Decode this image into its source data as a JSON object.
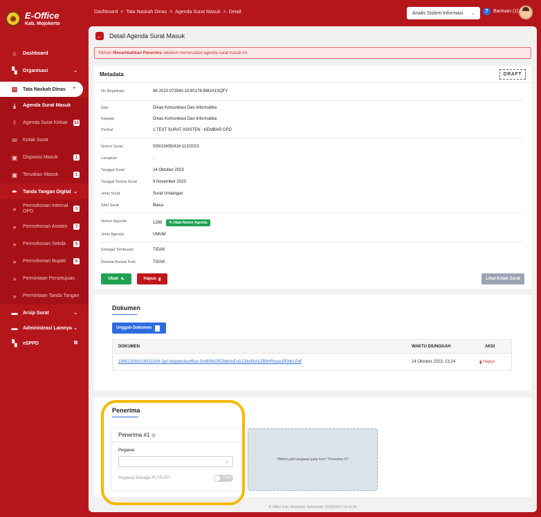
{
  "brand": {
    "title": "E-Office",
    "subtitle": "Kab. Mojokerto"
  },
  "sidebar": {
    "items": [
      {
        "label": "Dashboard",
        "icon": "home-icon"
      },
      {
        "label": "Organisasi",
        "icon": "organization-icon"
      },
      {
        "label": "Tata Naskah Dinas",
        "icon": "document-icon"
      },
      {
        "label": "Agenda Surat Masuk",
        "icon": "inbox-download-icon"
      },
      {
        "label": "Agenda Surat Keluar",
        "icon": "outbox-upload-icon",
        "badge": "52"
      },
      {
        "label": "Kotak Surat",
        "icon": "mail-icon"
      },
      {
        "label": "Disposisi Masuk",
        "icon": "disposition-icon",
        "badge": "1"
      },
      {
        "label": "Teruskan Masuk",
        "icon": "forward-icon",
        "badge": "1"
      },
      {
        "label": "Tanda Tangan Digital",
        "icon": "pen-nib-icon"
      },
      {
        "label": "Permohonan Internal OPD",
        "icon": "arrow-icon",
        "badge": "3"
      },
      {
        "label": "Permohonan Asisten",
        "icon": "arrow-icon",
        "badge": "7"
      },
      {
        "label": "Permohonan Sekda",
        "icon": "arrow-icon",
        "badge": "5"
      },
      {
        "label": "Permohonan Bupati",
        "icon": "arrow-icon",
        "badge": "5"
      },
      {
        "label": "Permintaan Persetujuan",
        "icon": "arrow-icon"
      },
      {
        "label": "Permintaan Tanda Tangan",
        "icon": "arrow-icon"
      },
      {
        "label": "Arsip Surat",
        "icon": "archive-icon"
      },
      {
        "label": "Administrasi Lainnya",
        "icon": "admin-icon"
      },
      {
        "label": "eSPPD",
        "icon": "file-icon"
      }
    ]
  },
  "breadcrumb": [
    "Dashboard",
    "Tata Naskah Dinas",
    "Agenda Surat Masuk",
    "Detail"
  ],
  "topbar": {
    "unit": "Analis Sistem Informasi",
    "help_label": "Bantuan (1)"
  },
  "page": {
    "title": "Detail Agenda Surat Masuk",
    "alert_prefix": "Mohon",
    "alert_bold": "Menambahkan Penerima",
    "alert_suffix": "sebelum meneruskan agenda surat masuk ini."
  },
  "metadata": {
    "title": "Metadata",
    "status": "DRAFT",
    "rows": [
      {
        "k": "No Registrasi",
        "v": "IM-2023.073540.10-80178-B8UH1SQFY"
      },
      {
        "k": "Dari",
        "v": "Dinas Komunikasi Dan Informatika"
      },
      {
        "k": "Kepada",
        "v": "Dinas Komunikasi Dan Informatika"
      },
      {
        "k": "Perihal",
        "v": "1 TEST SURAT ASISTEN - KEMBAR OPD"
      },
      {
        "k": "Nomor Surat",
        "v": "000/13405/416-113/2023"
      },
      {
        "k": "Lampiran",
        "v": "-"
      },
      {
        "k": "Tanggal Surat",
        "v": "24 Oktober 2023"
      },
      {
        "k": "Tanggal Terima Surat",
        "v": "9 November 2023"
      },
      {
        "k": "Jenis Surat",
        "v": "Surat Undangan"
      },
      {
        "k": "Sifat Surat",
        "v": "Biasa"
      },
      {
        "k": "Nomor Agenda",
        "v": "1288"
      },
      {
        "k": "Jenis Agenda",
        "v": "UMUM"
      },
      {
        "k": "Sebagai Tembusan",
        "v": "TIDAK"
      },
      {
        "k": "Disertai Berkas Fisik",
        "v": "TIDAK"
      }
    ],
    "ubah_nomor_label": "Ubah Nomor Agenda",
    "ubah_label": "Ubah",
    "hapus_label": "Hapus",
    "lihat_label": "Lihat Kotak Surat"
  },
  "dokumen": {
    "title": "Dokumen",
    "upload_label": "Unggah Dokumen",
    "columns": [
      "DOKUMEN",
      "WAKTU DIUNGGAH",
      "AKSI"
    ],
    "rows": [
      {
        "file": "199512092019031004-Spt-Helpdeskeoffice-SeIBRM2RZbbHicEnlLCBmRlAL2B6HRwueJP04trj.Pdf",
        "time": "24 Oktober 2023, 13:24",
        "action": "Hapus"
      }
    ]
  },
  "penerima": {
    "title": "Penerima",
    "card_title": "Penerima #1",
    "pegawai_label": "Pegawai",
    "toggle_label": "Pegawai Sebagai PLT/PJS?",
    "toggle_text": "Tidak",
    "placeholder_note": "*Mohon pilih pegawai pada form \"Penerima #1\""
  },
  "footer": "E-Office Kab. Mojokerto. beta-build: 21/09/2023-14:12:54",
  "colors": {
    "primary": "#b5161c",
    "accent_blue": "#2d6cdf",
    "success": "#1fa152",
    "highlight": "#f5b800"
  }
}
